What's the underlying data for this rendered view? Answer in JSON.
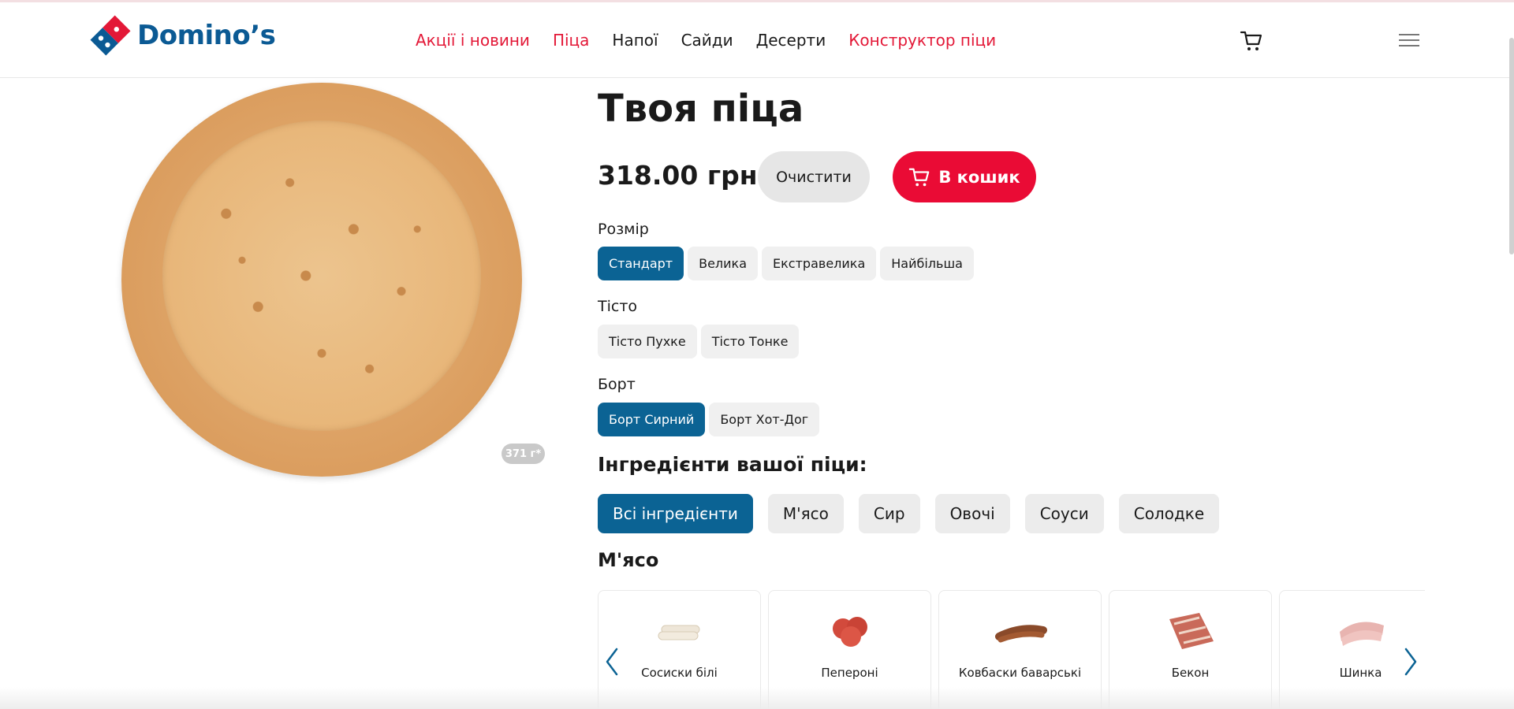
{
  "header": {
    "logo_text": "Domino’s",
    "nav": [
      {
        "label": "Акції і новини",
        "color": "#e31837"
      },
      {
        "label": "Піца",
        "color": "#e31837"
      },
      {
        "label": "Напої",
        "color": "#1a1a1a"
      },
      {
        "label": "Сайди",
        "color": "#1a1a1a"
      },
      {
        "label": "Десерти",
        "color": "#1a1a1a"
      },
      {
        "label": "Конструктор піци",
        "color": "#e31837"
      }
    ],
    "cart_icon": "cart-icon",
    "menu_icon": "hamburger-menu-icon"
  },
  "product": {
    "title": "Твоя піца",
    "price": "318.00 грн",
    "weight": "371 г*",
    "clear_label": "Очистити",
    "cart_label": "В кошик"
  },
  "options": {
    "size": {
      "label": "Розмір",
      "items": [
        "Стандарт",
        "Велика",
        "Екстравелика",
        "Найбільша"
      ],
      "selected": "Стандарт"
    },
    "dough": {
      "label": "Тісто",
      "items": [
        "Тісто Пухке",
        "Тісто Тонке"
      ],
      "selected": null
    },
    "crust": {
      "label": "Борт",
      "items": [
        "Борт Сирний",
        "Борт Хот-Дог"
      ],
      "selected": "Борт Сирний"
    }
  },
  "ingredients": {
    "heading": "Інгредієнти вашої піци:",
    "categories": [
      "Всі інгредієнти",
      "М'ясо",
      "Сир",
      "Овочі",
      "Соуси",
      "Солодке"
    ],
    "selected_category": "Всі інгредієнти",
    "section_title": "М'ясо",
    "items": [
      "Сосиски білі",
      "Пепероні",
      "Ковбаски баварські",
      "Бекон",
      "Шинка"
    ]
  },
  "colors": {
    "brand_blue": "#0b6394",
    "brand_red": "#ea0b35",
    "pill_bg": "#f0f0f0"
  }
}
